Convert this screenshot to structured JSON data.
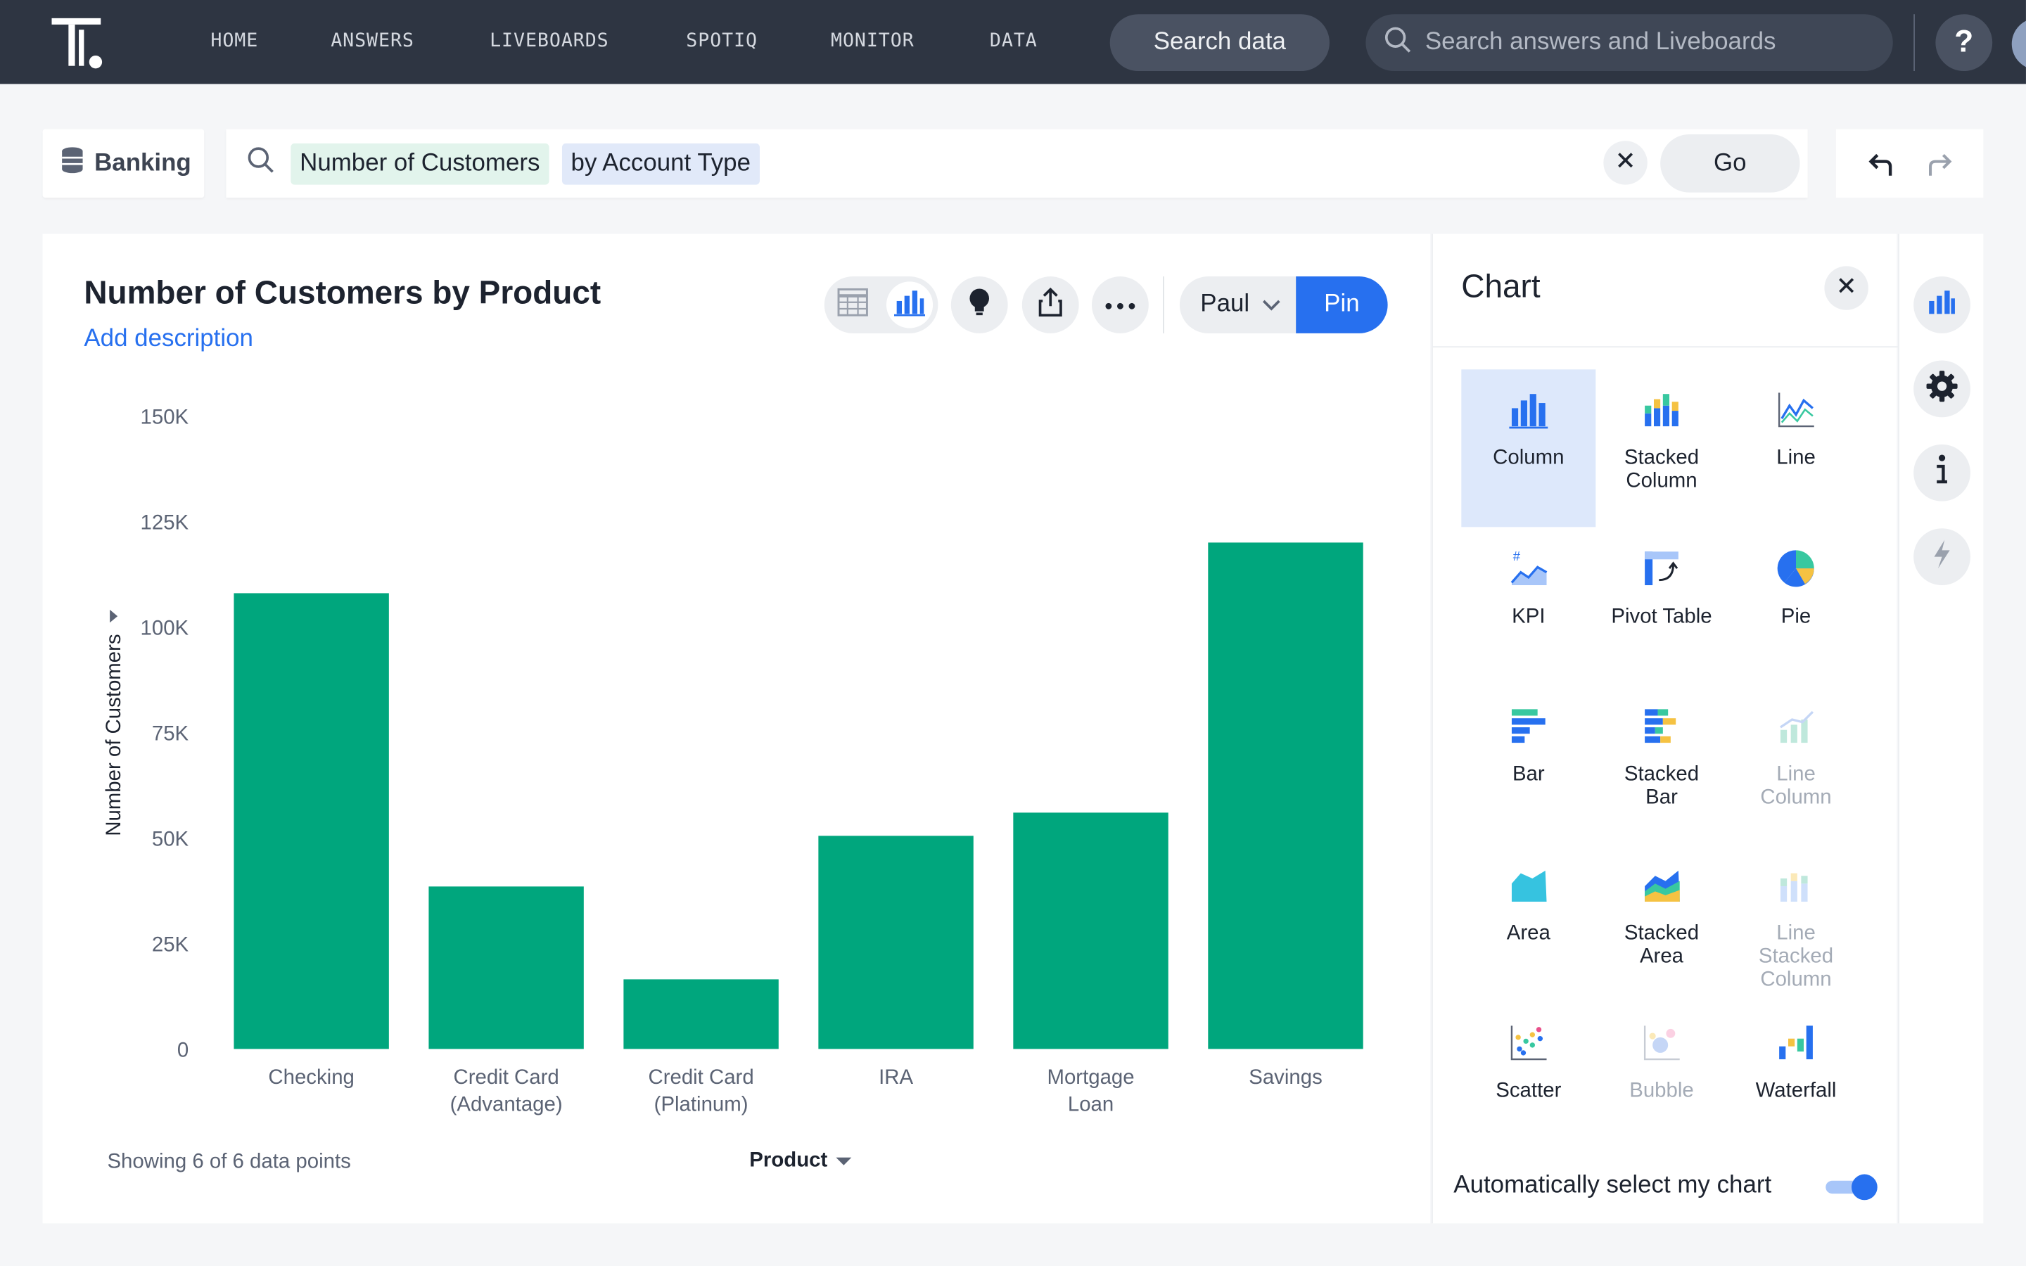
{
  "nav": {
    "links": [
      "HOME",
      "ANSWERS",
      "LIVEBOARDS",
      "SPOTIQ",
      "MONITOR",
      "DATA"
    ],
    "search_data_label": "Search data",
    "global_search_placeholder": "Search answers and Liveboards",
    "help_label": "?"
  },
  "search": {
    "source": "Banking",
    "tokens": [
      "Number of Customers",
      "by Account Type"
    ],
    "go_label": "Go"
  },
  "answer": {
    "title": "Number of Customers by Product",
    "add_description": "Add description",
    "owner_button": "Paul",
    "pin_label": "Pin",
    "footer_note": "Showing 6 of 6 data points",
    "x_dropdown": "Product"
  },
  "chart_data": {
    "type": "bar",
    "categories": [
      "Checking",
      "Credit Card (Advantage)",
      "Credit Card (Platinum)",
      "IRA",
      "Mortgage Loan",
      "Savings"
    ],
    "category_lines": [
      [
        "Checking"
      ],
      [
        "Credit Card",
        "(Advantage)"
      ],
      [
        "Credit Card",
        "(Platinum)"
      ],
      [
        "IRA"
      ],
      [
        "Mortgage",
        "Loan"
      ],
      [
        "Savings"
      ]
    ],
    "values": [
      108000,
      38500,
      16500,
      50500,
      56000,
      120000
    ],
    "ylabel": "Number of Customers",
    "xlabel": "Product",
    "ylim": [
      0,
      150000
    ],
    "y_ticks": [
      0,
      25000,
      50000,
      75000,
      100000,
      125000,
      150000
    ],
    "y_tick_labels": [
      "0",
      "25K",
      "50K",
      "75K",
      "100K",
      "125K",
      "150K"
    ],
    "bar_color": "#00a67d",
    "grid": false
  },
  "panel": {
    "title": "Chart",
    "chart_types": [
      {
        "lines": [
          "Column"
        ],
        "icon": "column-chart-icon",
        "selected": true,
        "dim": false
      },
      {
        "lines": [
          "Stacked",
          "Column"
        ],
        "icon": "stacked-column-chart-icon",
        "selected": false,
        "dim": false
      },
      {
        "lines": [
          "Line"
        ],
        "icon": "line-chart-icon",
        "selected": false,
        "dim": false
      },
      {
        "lines": [
          "KPI"
        ],
        "icon": "kpi-chart-icon",
        "selected": false,
        "dim": false
      },
      {
        "lines": [
          "Pivot Table"
        ],
        "icon": "pivot-table-icon",
        "selected": false,
        "dim": false
      },
      {
        "lines": [
          "Pie"
        ],
        "icon": "pie-chart-icon",
        "selected": false,
        "dim": false
      },
      {
        "lines": [
          "Bar"
        ],
        "icon": "bar-chart-icon",
        "selected": false,
        "dim": false
      },
      {
        "lines": [
          "Stacked",
          "Bar"
        ],
        "icon": "stacked-bar-chart-icon",
        "selected": false,
        "dim": false
      },
      {
        "lines": [
          "Line",
          "Column"
        ],
        "icon": "line-column-chart-icon",
        "selected": false,
        "dim": true
      },
      {
        "lines": [
          "Area"
        ],
        "icon": "area-chart-icon",
        "selected": false,
        "dim": false
      },
      {
        "lines": [
          "Stacked",
          "Area"
        ],
        "icon": "stacked-area-chart-icon",
        "selected": false,
        "dim": false
      },
      {
        "lines": [
          "Line",
          "Stacked",
          "Column"
        ],
        "icon": "line-stacked-column-chart-icon",
        "selected": false,
        "dim": true
      },
      {
        "lines": [
          "Scatter"
        ],
        "icon": "scatter-chart-icon",
        "selected": false,
        "dim": false
      },
      {
        "lines": [
          "Bubble"
        ],
        "icon": "bubble-chart-icon",
        "selected": false,
        "dim": true
      },
      {
        "lines": [
          "Waterfall"
        ],
        "icon": "waterfall-chart-icon",
        "selected": false,
        "dim": false
      }
    ],
    "auto_select_label": "Automatically select my chart",
    "auto_select_on": true
  },
  "colors": {
    "nav_bg": "#2e3542",
    "accent": "#2770ef",
    "bar": "#00a67d",
    "selected_tile": "#dde8fb"
  }
}
